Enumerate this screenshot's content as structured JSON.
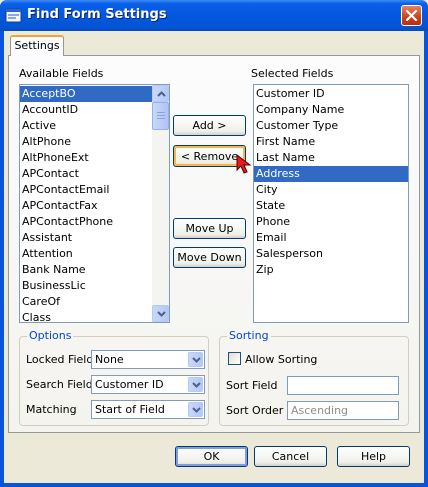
{
  "window": {
    "title": "Find Form Settings"
  },
  "tabs": [
    {
      "label": "Settings"
    }
  ],
  "available": {
    "label": "Available Fields",
    "items": [
      "AcceptBO",
      "AccountID",
      "Active",
      "AltPhone",
      "AltPhoneExt",
      "APContact",
      "APContactEmail",
      "APContactFax",
      "APContactPhone",
      "Assistant",
      "Attention",
      "Bank Name",
      "BusinessLic",
      "CareOf",
      "Class"
    ],
    "selected_index": 0
  },
  "selected": {
    "label": "Selected Fields",
    "items": [
      "Customer ID",
      "Company Name",
      "Customer Type",
      "First Name",
      "Last Name",
      "Address",
      "City",
      "State",
      "Phone",
      "Email",
      "Salesperson",
      "Zip"
    ],
    "selected_index": 5
  },
  "buttons": {
    "add": "Add >",
    "remove": "< Remove",
    "move_up": "Move Up",
    "move_down": "Move Down",
    "ok": "OK",
    "cancel": "Cancel",
    "help": "Help"
  },
  "options": {
    "title": "Options",
    "locked_field": {
      "label": "Locked Field",
      "value": "None"
    },
    "search_field": {
      "label": "Search Field",
      "value": "Customer ID"
    },
    "matching": {
      "label": "Matching",
      "value": "Start of Field"
    }
  },
  "sorting": {
    "title": "Sorting",
    "allow_sorting": {
      "label": "Allow Sorting",
      "checked": false
    },
    "sort_field": {
      "label": "Sort Field",
      "value": ""
    },
    "sort_order": {
      "label": "Sort Order",
      "value": "Ascending"
    }
  },
  "colors": {
    "titlebar": "#0458dc",
    "selection": "#316ac5",
    "group_title": "#0046d5",
    "tab_highlight": "#f1a43a",
    "pointer": "#e21b1b"
  },
  "icons": {
    "app": "app-icon",
    "close": "close-icon",
    "pointer": "mouse-pointer-icon"
  }
}
